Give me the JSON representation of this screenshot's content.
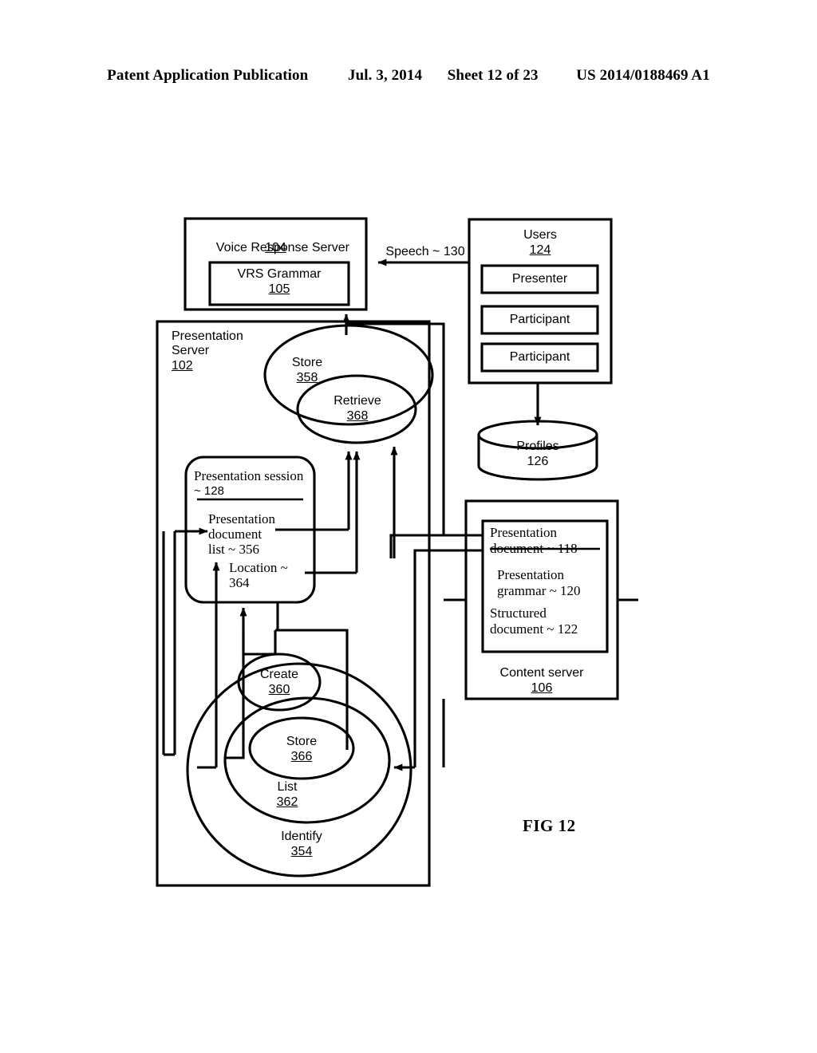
{
  "header": {
    "publication": "Patent Application Publication",
    "date": "Jul. 3, 2014",
    "sheet": "Sheet 12 of 23",
    "patent_number": "US 2014/0188469 A1"
  },
  "figure": {
    "caption": "FIG 12",
    "voice_response_server": {
      "title": "Voice Response Server",
      "ref": "104",
      "inner": {
        "title": "VRS Grammar",
        "ref": "105"
      }
    },
    "speech_link": {
      "label": "Speech ~ 130"
    },
    "users": {
      "title": "Users",
      "ref": "124",
      "items": [
        {
          "label": "Presenter"
        },
        {
          "label": "Participant"
        },
        {
          "label": "Participant"
        }
      ]
    },
    "profiles": {
      "title": "Profiles",
      "ref": "126"
    },
    "presentation_server": {
      "title_line1": "Presentation",
      "title_line2": "Server",
      "ref": "102"
    },
    "store_outer": {
      "title": "Store",
      "ref": "358"
    },
    "retrieve_inner": {
      "title": "Retrieve",
      "ref": "368"
    },
    "presentation_session": {
      "title_line1": "Presentation session",
      "title_line2": "~ 128",
      "doc_list_line1": "Presentation",
      "doc_list_line2": "document",
      "doc_list_line3": "list ~ 356",
      "location_line1": "Location ~",
      "location_line2": "364"
    },
    "content_server": {
      "title": "Content server",
      "ref": "106",
      "presentation_document_line1": "Presentation",
      "presentation_document_line2": "document ~ 118",
      "presentation_grammar_line1": "Presentation",
      "presentation_grammar_line2": "grammar ~ 120",
      "structured_document_line1": "Structured",
      "structured_document_line2": "document ~ 122"
    },
    "identify_outer": {
      "title": "Identify",
      "ref": "354"
    },
    "list_mid": {
      "title": "List",
      "ref": "362"
    },
    "store_inner": {
      "title": "Store",
      "ref": "366"
    },
    "create": {
      "title": "Create",
      "ref": "360"
    }
  },
  "colors": {
    "ink": "#000000",
    "paper": "#ffffff"
  }
}
